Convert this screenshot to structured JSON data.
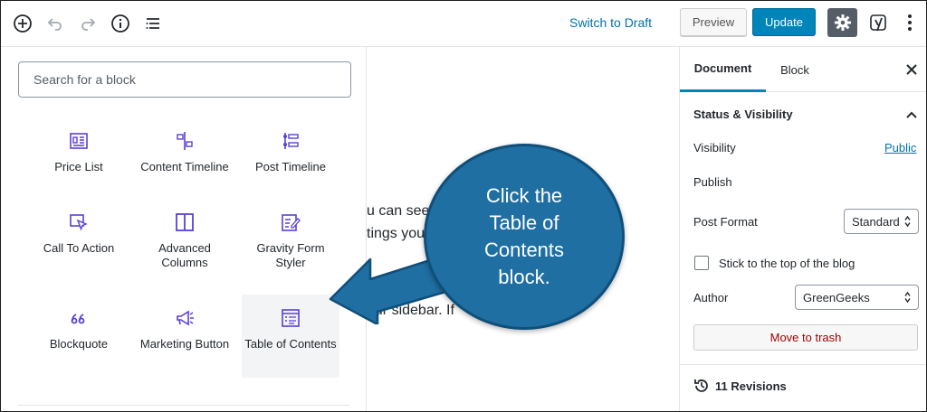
{
  "toolbar": {
    "switch_to_draft": "Switch to Draft",
    "preview": "Preview",
    "update": "Update",
    "icons": [
      "add-block-icon",
      "undo-icon",
      "redo-icon",
      "info-icon",
      "outline-icon",
      "settings-gear-icon",
      "yoast-icon",
      "more-menu-icon"
    ]
  },
  "inserter": {
    "search_placeholder": "Search for a block",
    "blocks": [
      {
        "label": "Price List",
        "icon": "price-list-icon"
      },
      {
        "label": "Content Timeline",
        "icon": "content-timeline-icon"
      },
      {
        "label": "Post Timeline",
        "icon": "post-timeline-icon"
      },
      {
        "label": "Call To Action",
        "icon": "call-to-action-icon"
      },
      {
        "label": "Advanced Columns",
        "icon": "advanced-columns-icon"
      },
      {
        "label": "Gravity Form Styler",
        "icon": "gravity-form-styler-icon"
      },
      {
        "label": "Blockquote",
        "icon": "blockquote-icon"
      },
      {
        "label": "Marketing Button",
        "icon": "marketing-button-icon"
      },
      {
        "label": "Table of Contents",
        "icon": "table-of-contents-icon"
      }
    ]
  },
  "editor": {
    "line1": "u can see t",
    "line2": "tings you",
    "line3": "our sidebar. If"
  },
  "callout": {
    "text": "Click the Table of Contents block."
  },
  "sidebar": {
    "tab_document": "Document",
    "tab_block": "Block",
    "panel_title": "Status & Visibility",
    "visibility_label": "Visibility",
    "visibility_value": "Public",
    "publish_label": "Publish",
    "post_format_label": "Post Format",
    "post_format_value": "Standard",
    "sticky_label": "Stick to the top of the blog",
    "author_label": "Author",
    "author_value": "GreenGeeks",
    "move_to_trash": "Move to trash",
    "revisions": "11 Revisions"
  },
  "colors": {
    "accent": "#0085ba",
    "link": "#0073aa",
    "block_icon": "#5b3fd6",
    "callout": "#1f6fa3",
    "trash": "#a00"
  }
}
